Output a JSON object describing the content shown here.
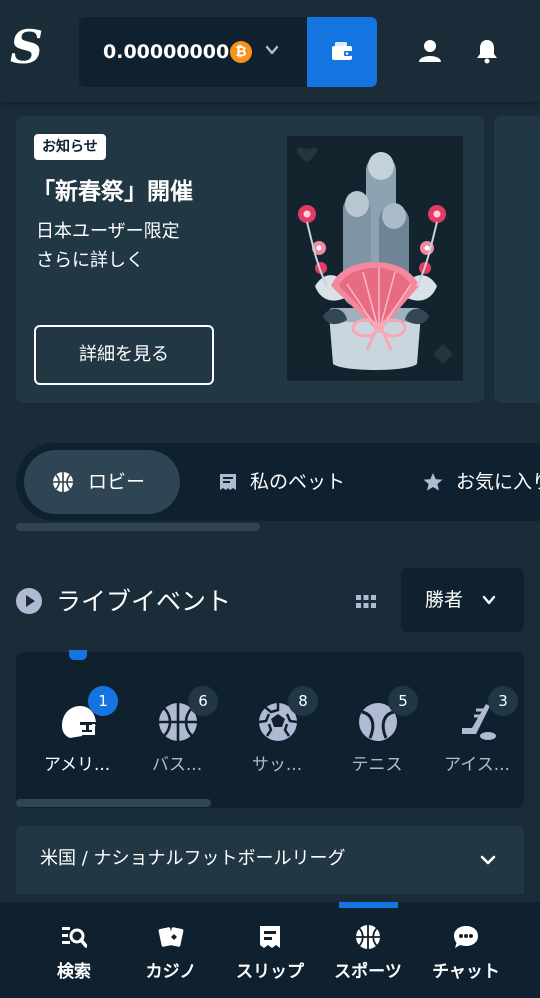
{
  "header": {
    "logo": "S",
    "balance": "0.00000000",
    "currency_symbol": "₿",
    "colors": {
      "wallet_button": "#1475e1",
      "btc": "#f7931a"
    }
  },
  "promo": {
    "badge": "お知らせ",
    "title": "「新春祭」開催",
    "subtitle_line1": "日本ユーザー限定",
    "subtitle_line2": "さらに詳しく",
    "button": "詳細を見る"
  },
  "tabs": [
    {
      "label": "ロビー",
      "icon": "basketball-icon",
      "active": true
    },
    {
      "label": "私のベット",
      "icon": "betslip-icon",
      "active": false
    },
    {
      "label": "お気に入り",
      "icon": "star-icon",
      "active": false
    }
  ],
  "live": {
    "title": "ライブイベント",
    "market": "勝者"
  },
  "sports": [
    {
      "label": "アメリ...",
      "count": "1",
      "icon": "american-football-icon",
      "active": true
    },
    {
      "label": "バス...",
      "count": "6",
      "icon": "basketball-icon",
      "active": false
    },
    {
      "label": "サッ...",
      "count": "8",
      "icon": "soccer-icon",
      "active": false
    },
    {
      "label": "テニス",
      "count": "5",
      "icon": "tennis-icon",
      "active": false
    },
    {
      "label": "アイス...",
      "count": "3",
      "icon": "ice-hockey-icon",
      "active": false
    }
  ],
  "league": {
    "label": "米国 / ナショナルフットボールリーグ"
  },
  "bottom_nav": [
    {
      "label": "検索",
      "icon": "search-icon"
    },
    {
      "label": "カジノ",
      "icon": "cards-icon"
    },
    {
      "label": "スリップ",
      "icon": "betslip-icon"
    },
    {
      "label": "スポーツ",
      "icon": "basketball-icon",
      "active": true
    },
    {
      "label": "チャット",
      "icon": "chat-icon"
    }
  ]
}
